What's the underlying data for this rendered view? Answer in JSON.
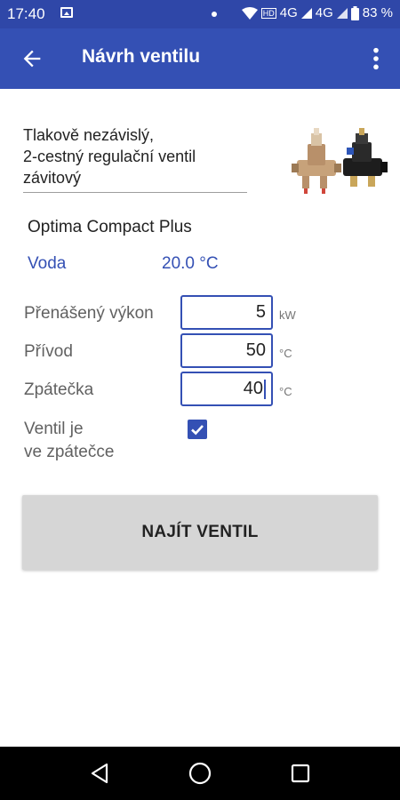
{
  "status_bar": {
    "time": "17:40",
    "network": "4G",
    "network2": "4G",
    "battery": "83 %"
  },
  "app_bar": {
    "title": "Návrh ventilu"
  },
  "valve": {
    "description_line1": "Tlakově nezávislý,",
    "description_line2": "2-cestný regulační ventil",
    "description_line3": "závitový",
    "product_name": "Optima Compact Plus"
  },
  "medium": {
    "label": "Voda",
    "temperature": "20.0 °C"
  },
  "fields": {
    "power": {
      "label": "Přenášený výkon",
      "value": "5",
      "unit": "kW"
    },
    "supply": {
      "label": "Přívod",
      "value": "50",
      "unit": "°C"
    },
    "return": {
      "label": "Zpátečka",
      "value": "40",
      "unit": "°C"
    }
  },
  "checkbox": {
    "label_line1": "Ventil je",
    "label_line2": "ve zpátečce",
    "checked": true
  },
  "find_button": {
    "label": "NAJÍT VENTIL"
  },
  "colors": {
    "primary": "#3450b4",
    "status_bar": "#2f47a8",
    "button_bg": "#d6d6d6"
  }
}
